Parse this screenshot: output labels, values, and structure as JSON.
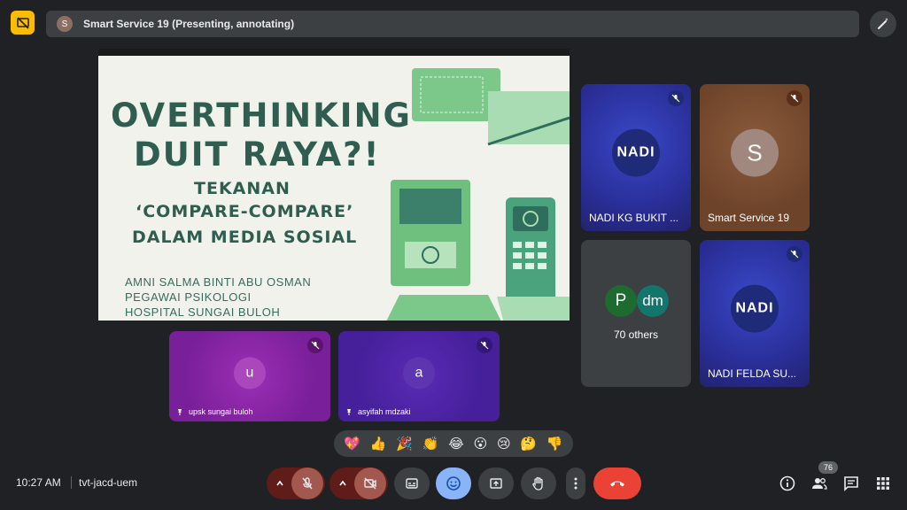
{
  "presentation": {
    "presenter_initial": "S",
    "title": "Smart Service 19 (Presenting, annotating)"
  },
  "slide": {
    "line1": "OVERTHINKING",
    "line2": "DUIT RAYA?!",
    "line3": "TEKANAN",
    "line4": "‘COMPARE-COMPARE’",
    "line5": "DALAM MEDIA SOSIAL",
    "author": "AMNI SALMA BINTI ABU OSMAN",
    "role": "PEGAWAI PSIKOLOGI",
    "org": "HOSPITAL SUNGAI BULOH"
  },
  "tiles": {
    "nadi_bukit": {
      "name": "NADI KG BUKIT ...",
      "logo": "NADI"
    },
    "smart_service": {
      "name": "Smart Service 19",
      "initial": "S"
    },
    "others": {
      "av1": "P",
      "av2": "dm",
      "label": "70 others"
    },
    "nadi_felda": {
      "name": "NADI FELDA SU...",
      "logo": "NADI"
    },
    "upsk": {
      "initial": "u",
      "name": "upsk sungai buloh"
    },
    "asyifah": {
      "initial": "a",
      "name": "asyifah mdzaki"
    }
  },
  "reactions": [
    "💖",
    "👍",
    "🎉",
    "👏",
    "😂",
    "😮",
    "😢",
    "🤔",
    "👎"
  ],
  "bottom": {
    "time": "10:27 AM",
    "meeting_code": "tvt-jacd-uem",
    "participants_count": "76"
  },
  "colors": {
    "background": "#202124",
    "hangup": "#ea4335",
    "emoji_active": "#8ab4f8",
    "warning_icon": "#fbbc04"
  }
}
